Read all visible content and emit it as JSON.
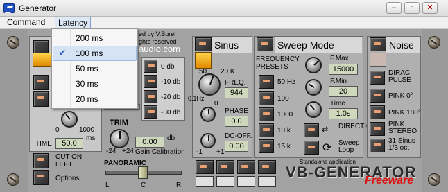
{
  "window": {
    "title": "Generator",
    "buttons": {
      "minimize": "–",
      "maximize": "▫",
      "close": "✕"
    }
  },
  "menu": {
    "items": [
      "Command",
      "Latency"
    ]
  },
  "latency_menu": {
    "items": [
      "200 ms",
      "100 ms",
      "50 ms",
      "30 ms",
      "20 ms"
    ],
    "selected": "100 ms"
  },
  "credits": {
    "line1": "ed by V.Burel",
    "line2": "ghts reserved",
    "line3": "audio.com"
  },
  "db_buttons": [
    "0 db",
    "-10 db",
    "-20 db",
    "-30 db"
  ],
  "left": {
    "knob_min": "0",
    "knob_max": "1000",
    "time_label": "TIME",
    "time_value": "50.0",
    "time_unit": "ms",
    "cut_on_left": "CUT ON LEFT",
    "options": "Options"
  },
  "trim": {
    "label": "TRIM",
    "min": "-24",
    "max": "+24",
    "value": "0.00",
    "unit": "db",
    "gain_cal": "Gain Calibration"
  },
  "panoramic": {
    "label": "PANORAMIC",
    "l": "L",
    "c": "C",
    "r": "R"
  },
  "sinus": {
    "label": "Sinus",
    "scale_low": "50",
    "scale_high": "20 K",
    "scale_sub": "0.1Hz",
    "freq_label": "FREQ.",
    "freq_value": "944",
    "phase_label": "PHASE",
    "phase_value": "0.0",
    "phase_scale": "0",
    "dc_label": "DC-OFF.",
    "dc_value": "0.00",
    "dc_min": "-1",
    "dc_max": "+1"
  },
  "sweep": {
    "label": "Sweep Mode",
    "presets_title": "FREQUENCY PRESETS",
    "presets": [
      "50 Hz",
      "100",
      "1000",
      "10 k",
      "15 k"
    ],
    "fmax_label": "F.Max",
    "fmax_value": "15000",
    "fmin_label": "F.Min",
    "fmin_value": "20",
    "time_label": "Time",
    "time_value": "1.0s",
    "directions": "DIRECTIONS",
    "sweep_loop": "Sweep Loop"
  },
  "noise": {
    "label": "Noise",
    "items": [
      "DIRAC PULSE",
      "PINK 0°",
      "PINK 180°",
      "PINK STEREO",
      "31 Sinus 1/3 oct"
    ]
  },
  "footer": {
    "standalone": "Standalone application",
    "product": "VB-GENERATOR",
    "freeware": "Freeware"
  }
}
